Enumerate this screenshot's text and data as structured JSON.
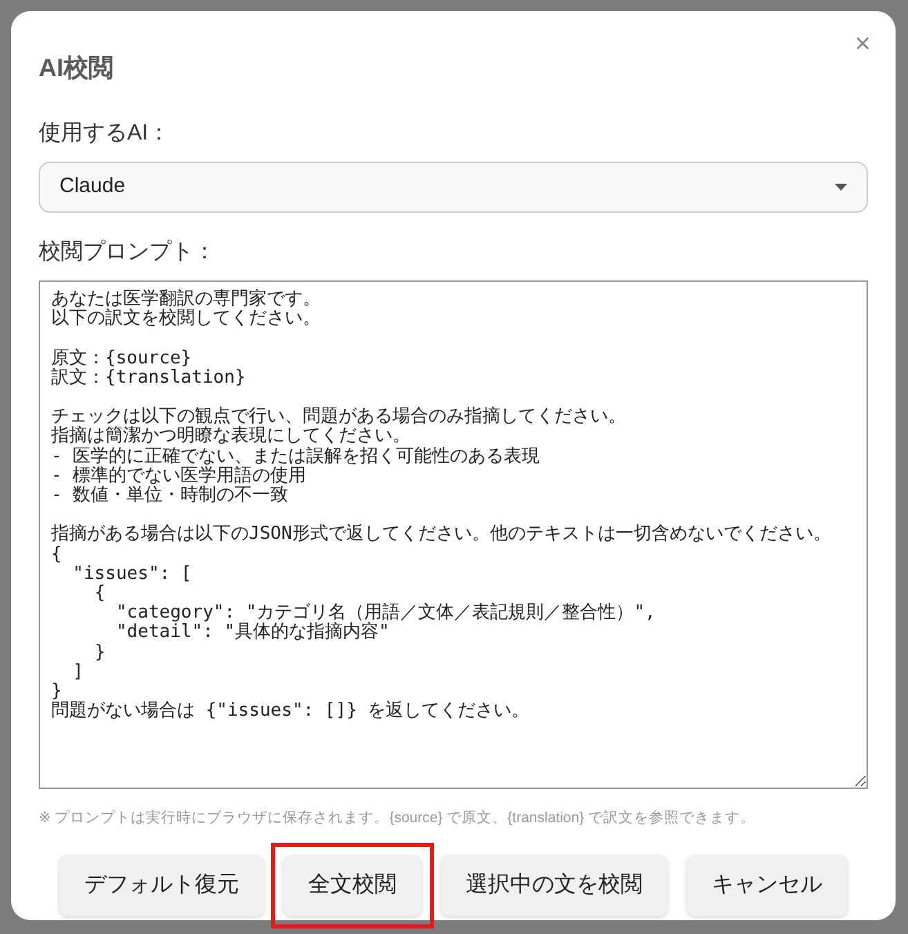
{
  "dialog": {
    "title": "AI校閲",
    "close": "×",
    "ai_label": "使用するAI：",
    "ai_select": {
      "value": "Claude"
    },
    "prompt_label": "校閲プロンプト：",
    "prompt": {
      "paragraphs": [
        [
          "あなたは医学翻訳の専門家です。",
          "以下の訳文を校閲してください。"
        ],
        [
          "原文：{source}",
          "訳文：{translation}"
        ],
        [
          "チェックは以下の観点で行い、問題がある場合のみ指摘してください。",
          "指摘は簡潔かつ明瞭な表現にしてください。",
          "- 医学的に正確でない、または誤解を招く可能性のある表現",
          "- 標準的でない医学用語の使用",
          "- 数値・単位・時制の不一致"
        ],
        [
          "指摘がある場合は以下のJSON形式で返してください。他のテキストは一切含めないでください。",
          "{",
          "  \"issues\": [",
          "    {",
          "      \"category\": \"カテゴリ名（用語／文体／表記規則／整合性）\",",
          "      \"detail\": \"具体的な指摘内容\"",
          "    }",
          "  ]",
          "}",
          "問題がない場合は {\"issues\": []} を返してください。"
        ]
      ]
    },
    "note": "※ プロンプトは実行時にブラウザに保存されます。{source} で原文、{translation} で訳文を参照できます。",
    "buttons": [
      {
        "label": "デフォルト復元",
        "highlighted": false
      },
      {
        "label": "全文校閲",
        "highlighted": true
      },
      {
        "label": "選択中の文を校閲",
        "highlighted": false
      },
      {
        "label": "キャンセル",
        "highlighted": false
      }
    ]
  }
}
